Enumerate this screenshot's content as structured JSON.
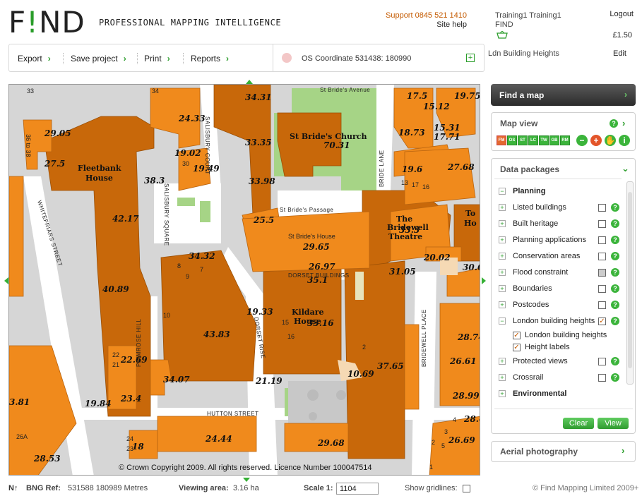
{
  "header": {
    "logo_text": "F!ND",
    "tagline": "PROFESSIONAL MAPPING INTELLIGENCE",
    "support": "Support 0845 521 1410",
    "site_help": "Site help",
    "user_name": "Training1 Training1",
    "user_org": "FIND",
    "logout": "Logout",
    "price": "£1.50"
  },
  "toolbar": {
    "export": "Export",
    "save": "Save project",
    "print": "Print",
    "reports": "Reports",
    "coordinate": "OS Coordinate 531438: 180990"
  },
  "project": {
    "name": "Ldn Building Heights",
    "edit": "Edit"
  },
  "map": {
    "copyright": "© Crown Copyright 2009. All rights reserved. Licence Number 100047514",
    "places": {
      "church": "St Bride's Church",
      "fleetbank": "Fleetbank",
      "house": "House",
      "bride_house": "St Bride's House",
      "bride_passage": "St Bride's Passage",
      "bride_avenue": "St Bride's Avenue",
      "bridewell_theatre_the": "The",
      "bridewell_theatre_b": "Bridewell",
      "bridewell_theatre_c": "Theatre",
      "kildare": "Kildare",
      "kildare_house": "House",
      "salisbury_square": "SALISBURY SQUARE",
      "salisbury_court": "SALISBURY COURT",
      "whitefriars": "WHITEFRIARS STREET",
      "dorset_rise": "DORSET RISE",
      "dorset_buildings": "DORSET BUILDINGS",
      "primrose_hill": "PRIMROSE HILL",
      "bridewell_place": "BRIDEWELL PLACE",
      "hutton": "HUTTON STREET",
      "bride_lane": "BRIDE LANE",
      "to": "To",
      "ho": "Ho"
    },
    "heights": [
      "34.31",
      "24.33",
      "17.5",
      "15.12",
      "19.75",
      "29.05",
      "70.31",
      "33.35",
      "18.73",
      "15.31",
      "17.71",
      "27.5",
      "19.02",
      "19.49",
      "38.3",
      "19.6",
      "27.68",
      "33.98",
      "42.17",
      "25.5",
      "29.65",
      "33.3",
      "34.32",
      "26.97",
      "20.02",
      "30.6",
      "35.1",
      "31.05",
      "40.89",
      "19.33",
      "33.16",
      "43.83",
      "28.74",
      "22.69",
      "26.61",
      "10.69",
      "37.65",
      "34.07",
      "21.19",
      "23.4",
      "28.99",
      "19.84",
      "3.81",
      "28.4",
      "24.44",
      "29.68",
      "18",
      "26.69",
      "28.53"
    ],
    "small_numbers": [
      "33",
      "36 to 38",
      "34",
      "30",
      "8",
      "9",
      "7",
      "10",
      "15",
      "16",
      "2",
      "22",
      "21",
      "24",
      "23",
      "3",
      "4",
      "5",
      "26A",
      "17",
      "16",
      "13",
      "1",
      "2"
    ]
  },
  "status": {
    "bng_label": "BNG Ref:",
    "bng_value": "531588  180989 Metres",
    "viewing_label": "Viewing area:",
    "viewing_value": "3.16 ha",
    "scale_label": "Scale 1:",
    "scale_value": "1104",
    "gridlines": "Show gridlines:",
    "footer": "© Find Mapping Limited 2009+"
  },
  "panel": {
    "find_map": "Find a map",
    "map_view": "Map view",
    "view_buttons": [
      "FM",
      "OS",
      "ST",
      "LC",
      "TW",
      "GB",
      "RM"
    ],
    "data_packages": "Data packages",
    "items": [
      {
        "label": "Planning",
        "head": true,
        "exp": "−"
      },
      {
        "label": "Listed buildings",
        "exp": "+"
      },
      {
        "label": "Built heritage",
        "exp": "+"
      },
      {
        "label": "Planning applications",
        "exp": "+"
      },
      {
        "label": "Conservation areas",
        "exp": "+"
      },
      {
        "label": "Flood constraint",
        "exp": "+"
      },
      {
        "label": "Boundaries",
        "exp": "+"
      },
      {
        "label": "Postcodes",
        "exp": "+"
      },
      {
        "label": "London building heights",
        "exp": "−",
        "checked": true
      }
    ],
    "sub_items": [
      "London building heights",
      "Height labels"
    ],
    "items_after": [
      {
        "label": "Protected views",
        "exp": "+"
      },
      {
        "label": "Crossrail",
        "exp": "+"
      },
      {
        "label": "Environmental",
        "head": true,
        "exp": "+"
      }
    ],
    "clear": "Clear",
    "view": "View",
    "aerial": "Aerial photography"
  },
  "colors": {
    "building": "#f08a1c",
    "building_dark": "#c8680a",
    "accent_green": "#3bb43b",
    "support_orange": "#c45a00"
  }
}
